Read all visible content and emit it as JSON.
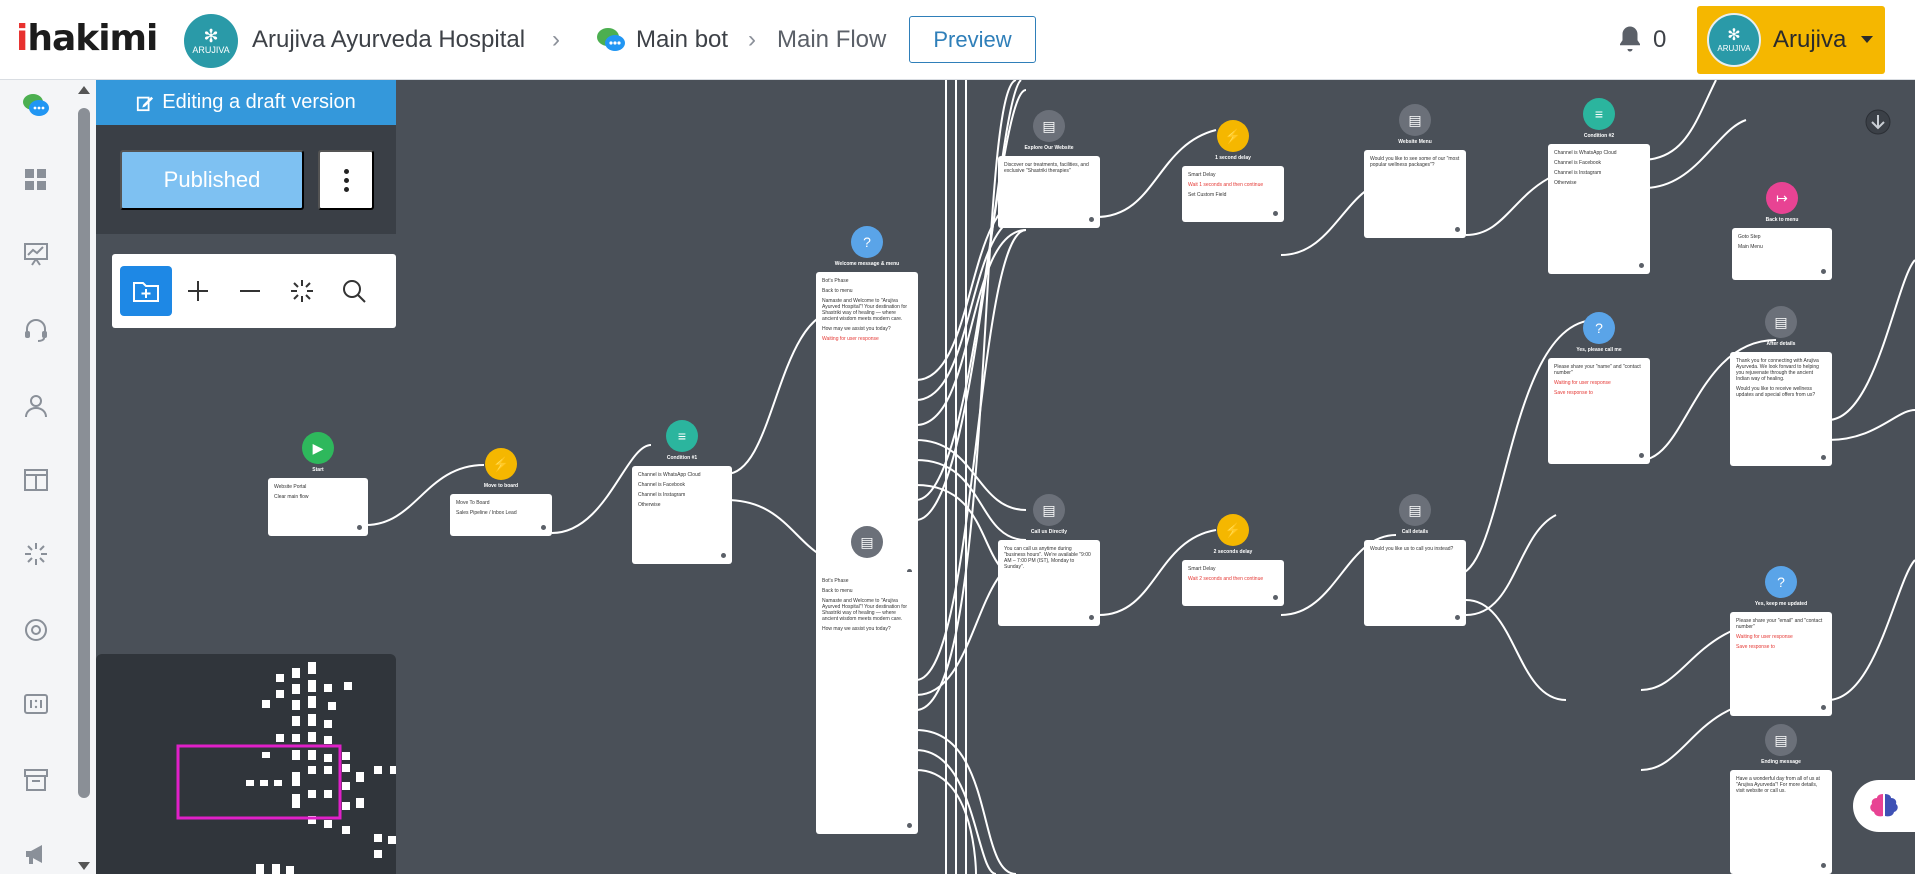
{
  "header": {
    "logo_text": "ihakimi",
    "org_name": "Arujiva Ayurveda Hospital",
    "org_avatar_text": "ARUJIVA",
    "bot_name": "Main bot",
    "flow_name": "Main Flow",
    "preview_label": "Preview",
    "notification_count": "0",
    "user_name": "Arujiva",
    "user_avatar_text": "ARUJIVA"
  },
  "sidebar": {
    "items": [
      {
        "icon": "chat-bot-icon"
      },
      {
        "icon": "dashboard-icon"
      },
      {
        "icon": "presentation-chart-icon"
      },
      {
        "icon": "headset-icon"
      },
      {
        "icon": "user-icon"
      },
      {
        "icon": "layout-icon"
      },
      {
        "icon": "sparkle-icon"
      },
      {
        "icon": "lifebuoy-icon"
      },
      {
        "icon": "ratio-icon"
      },
      {
        "icon": "archive-icon"
      },
      {
        "icon": "megaphone-icon"
      }
    ]
  },
  "editor": {
    "draft_label": "Editing a draft version",
    "published_label": "Published",
    "toolbar": [
      "add-folder-icon",
      "zoom-in-icon",
      "zoom-out-icon",
      "fit-view-icon",
      "search-icon"
    ]
  },
  "flow_nodes": [
    {
      "title": "Start",
      "lines": [
        "Website Portal",
        "Clear main flow"
      ],
      "color": "#2eb85c"
    },
    {
      "title": "Move to board",
      "lines": [
        "Move To Board",
        "Sales Pipeline / Inbox Lead"
      ],
      "color": "#f5b700"
    },
    {
      "title": "Condition #1",
      "lines": [
        "Channel is WhatsApp Cloud",
        "Channel is Facebook",
        "Channel is Instagram",
        "Otherwise"
      ],
      "color": "#2bb59e"
    },
    {
      "title": "Welcome message & menu",
      "lines": [
        "Bot's Phase",
        "Back to menu",
        "Namaste and Welcome to \"Arujiva Ayurved Hospital\"! Your destination for Shastriki way of healing — where ancient wisdom meets modern care.",
        "How may we assist you today?",
        "Waiting for user response"
      ],
      "color": "#5aa4e8"
    },
    {
      "title": "Land Message #14",
      "lines": [
        "Bot's Phase",
        "Back to menu",
        "Namaste and Welcome to \"Arujiva Ayurved Hospital\"! Your destination for Shastriki way of healing — where ancient wisdom meets modern care.",
        "How may we assist you today?"
      ],
      "color": "#6b7079"
    },
    {
      "title": "Explore Our Website",
      "lines": [
        "Discover our treatments, facilities, and exclusive \"Shastriki therapies\""
      ],
      "color": "#6b7079"
    },
    {
      "title": "1 second delay",
      "lines": [
        "Smart Delay",
        "Wait 1 seconds and then continue",
        "Set Custom Field"
      ],
      "color": "#f5b700"
    },
    {
      "title": "Website Menu",
      "lines": [
        "Would you like to see some of our \"most popular wellness packages\"?"
      ],
      "color": "#6b7079"
    },
    {
      "title": "Condition #2",
      "lines": [
        "Channel is WhatsApp Cloud",
        "Channel is Facebook",
        "Channel is Instagram",
        "Otherwise"
      ],
      "color": "#2bb59e"
    },
    {
      "title": "Call us Directly",
      "lines": [
        "You can call us anytime during \"business hours\". We're available \"9:00 AM – 7:00 PM (IST), Monday to Sunday\"."
      ],
      "color": "#6b7079"
    },
    {
      "title": "2 seconds delay",
      "lines": [
        "Smart Delay",
        "Wait 2 seconds and then continue"
      ],
      "color": "#f5b700"
    },
    {
      "title": "Call details",
      "lines": [
        "Would you like us to call you instead?"
      ],
      "color": "#6b7079"
    },
    {
      "title": "Yes, please call me",
      "lines": [
        "Please share your \"name\" and \"contact number\"",
        "Waiting for user response",
        "Save response to"
      ],
      "color": "#5aa4e8"
    },
    {
      "title": "After details",
      "lines": [
        "Thank you for connecting with Arujiva Ayurveda. We look forward to helping you rejuvenate through the ancient Indian way of healing.",
        "Would you like to receive wellness updates and special offers from us?"
      ],
      "color": "#6b7079"
    },
    {
      "title": "Back to menu",
      "lines": [
        "Goto Step",
        "Main Menu"
      ],
      "color": "#e84393"
    },
    {
      "title": "Yes, keep me updated",
      "lines": [
        "Please share your \"email\" and \"contact number\"",
        "Waiting for user response",
        "Save response to"
      ],
      "color": "#5aa4e8"
    },
    {
      "title": "Ending message",
      "lines": [
        "Have a wonderful day from all of us at \"Arujiva Ayurveda\"! For more details, visit website or call us."
      ],
      "color": "#6b7079"
    }
  ],
  "colors": {
    "brand_blue": "#3498db",
    "accent_yellow": "#f5b700",
    "canvas_bg": "#4a5058",
    "minimap_viewport": "#e020c8"
  }
}
